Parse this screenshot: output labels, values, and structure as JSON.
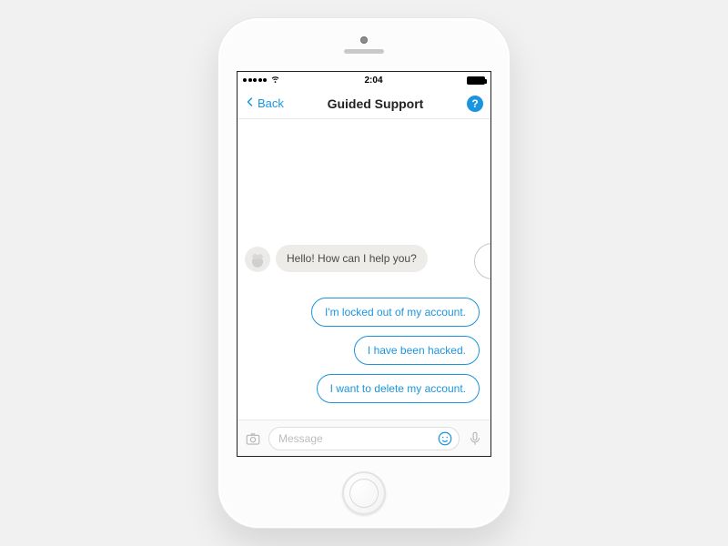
{
  "statusbar": {
    "time": "2:04"
  },
  "navbar": {
    "back_label": "Back",
    "title": "Guided Support",
    "help_glyph": "?"
  },
  "chat": {
    "bot_message": "Hello! How can I help you?",
    "quick_replies": [
      "I'm locked out of my account.",
      "I have been hacked.",
      "I want to delete my account."
    ]
  },
  "inputbar": {
    "placeholder": "Message"
  },
  "colors": {
    "accent": "#1a95e0"
  }
}
